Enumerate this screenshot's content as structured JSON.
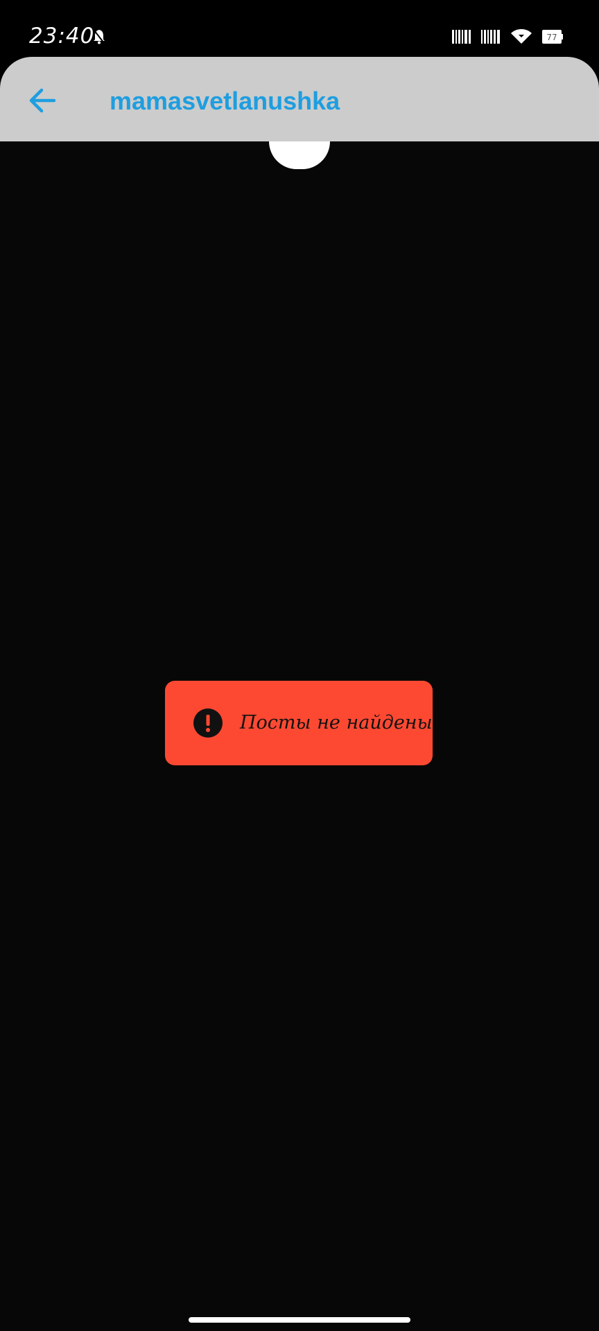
{
  "status_bar": {
    "time": "23:40",
    "icons": {
      "notification": "bell-icon",
      "signal1": "signal-icon",
      "signal2": "signal-icon",
      "wifi": "wifi-icon",
      "battery": "battery-icon"
    },
    "battery_level": "77"
  },
  "app_bar": {
    "back_icon": "arrow-left-icon",
    "title": "mamasvetlanushka",
    "background": "#cccccc",
    "title_color": "#1e9ee0"
  },
  "toast": {
    "icon": "error-exclamation-icon",
    "message": "Посты не найдены",
    "background": "#fe4932"
  },
  "colors": {
    "content_background": "#070707"
  }
}
